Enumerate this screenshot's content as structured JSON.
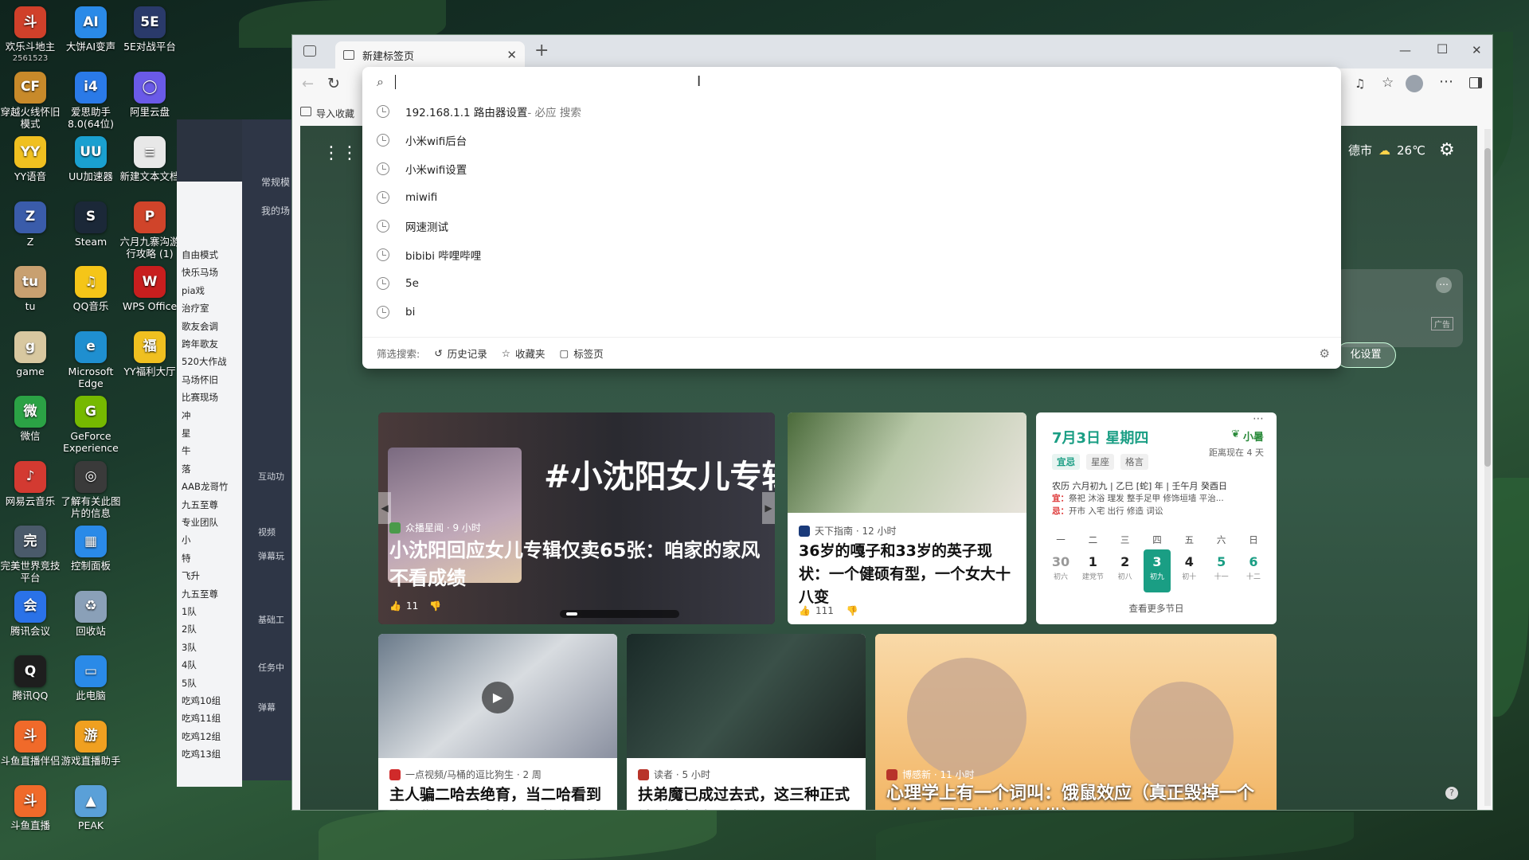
{
  "desktop": {
    "col1": [
      {
        "label": "欢乐斗地主",
        "sub": "2561523",
        "icon": "doudizhu-icon",
        "color": "#d0402a",
        "glyph": "斗"
      },
      {
        "label": "穿越火线怀旧模式",
        "icon": "cf-icon",
        "color": "#c88a2a",
        "glyph": "CF"
      },
      {
        "label": "YY语音",
        "icon": "yy-icon",
        "color": "#f0c020",
        "glyph": "YY"
      },
      {
        "label": "Z",
        "icon": "folder-z-icon",
        "color": "#3a5caa",
        "glyph": "Z"
      },
      {
        "label": "tu",
        "icon": "folder-tu-icon",
        "color": "#c8a070",
        "glyph": "tu"
      },
      {
        "label": "game",
        "icon": "folder-game-icon",
        "color": "#d8c8a0",
        "glyph": "g"
      },
      {
        "label": "微信",
        "icon": "wechat-icon",
        "color": "#2ba245",
        "glyph": "微"
      },
      {
        "label": "网易云音乐",
        "icon": "netease-music-icon",
        "color": "#d33a31",
        "glyph": "♪"
      },
      {
        "label": "完美世界竞技平台",
        "icon": "perfect-world-icon",
        "color": "#4a5a6a",
        "glyph": "完"
      },
      {
        "label": "腾讯会议",
        "icon": "tencent-meeting-icon",
        "color": "#2a72e8",
        "glyph": "会"
      },
      {
        "label": "腾讯QQ",
        "icon": "qq-icon",
        "color": "#1e1e1e",
        "glyph": "Q"
      },
      {
        "label": "斗鱼直播伴侣",
        "icon": "douyu-partner-icon",
        "color": "#f06a2a",
        "glyph": "斗"
      },
      {
        "label": "斗鱼直播",
        "icon": "douyu-icon",
        "color": "#f06a2a",
        "glyph": "斗"
      }
    ],
    "col2": [
      {
        "label": "大饼AI变声",
        "icon": "ai-voice-icon",
        "color": "#2a8ae8",
        "glyph": "AI"
      },
      {
        "label": "爱思助手8.0(64位)",
        "icon": "i4-icon",
        "color": "#2a7ae8",
        "glyph": "i4"
      },
      {
        "label": "UU加速器",
        "icon": "uu-icon",
        "color": "#1aa0d0",
        "glyph": "UU"
      },
      {
        "label": "Steam",
        "icon": "steam-icon",
        "color": "#1b2838",
        "glyph": "S"
      },
      {
        "label": "QQ音乐",
        "icon": "qq-music-icon",
        "color": "#f5c518",
        "glyph": "♫"
      },
      {
        "label": "Microsoft Edge",
        "icon": "edge-icon",
        "color": "#1f8fd0",
        "glyph": "e"
      },
      {
        "label": "GeForce Experience",
        "icon": "geforce-icon",
        "color": "#76b900",
        "glyph": "G"
      },
      {
        "label": "了解有关此图片的信息",
        "icon": "info-camera-icon",
        "color": "#3a3a3a",
        "glyph": "◎"
      },
      {
        "label": "控制面板",
        "icon": "control-panel-icon",
        "color": "#2a8ae8",
        "glyph": "▦"
      },
      {
        "label": "回收站",
        "icon": "recycle-bin-icon",
        "color": "#8aa0b8",
        "glyph": "♻"
      },
      {
        "label": "此电脑",
        "icon": "this-pc-icon",
        "color": "#2a8ae8",
        "glyph": "▭"
      },
      {
        "label": "游戏直播助手",
        "icon": "game-live-icon",
        "color": "#f0a020",
        "glyph": "游"
      },
      {
        "label": "PEAK",
        "icon": "peak-icon",
        "color": "#5aa0d8",
        "glyph": "▲"
      }
    ],
    "col3": [
      {
        "label": "5E对战平台",
        "icon": "5e-icon",
        "color": "#2a3a6a",
        "glyph": "5E"
      },
      {
        "label": "阿里云盘",
        "icon": "aliyun-drive-icon",
        "color": "#6a5ae8",
        "glyph": "◯"
      },
      {
        "label": "新建文本文档",
        "icon": "text-doc-icon",
        "color": "#e8e8e8",
        "glyph": "≡"
      },
      {
        "label": "六月九寨沟游行攻略 (1)",
        "icon": "ppt-icon",
        "color": "#d0442a",
        "glyph": "P"
      },
      {
        "label": "WPS Office",
        "icon": "wps-icon",
        "color": "#c81e1e",
        "glyph": "W"
      },
      {
        "label": "YY福利大厅",
        "icon": "yy-welfare-icon",
        "color": "#f0c020",
        "glyph": "福"
      }
    ]
  },
  "bgapp": {
    "tabs": [
      "常规模",
      "我的场"
    ],
    "tree": [
      "自由模式",
      "快乐马场",
      "pia戏",
      "治疗室",
      "歌友会调",
      "跨年歌友",
      "520大作战",
      "马场怀旧",
      "比赛现场",
      "冲",
      "星",
      "牛",
      "落",
      "AAB龙哥竹",
      "九五至尊",
      "专业团队",
      "小",
      "特",
      "飞升",
      "九五至尊",
      "1队",
      "2队",
      "3队",
      "4队",
      "5队",
      "吃鸡10组",
      "吃鸡11组",
      "吃鸡12组",
      "吃鸡13组"
    ],
    "side_labels": [
      "互动功",
      "视频",
      "弹幕玩",
      "基础工",
      "任务中",
      "弹幕"
    ]
  },
  "browser": {
    "tab_title": "新建标签页",
    "fav_import": "导入收藏",
    "search": {
      "value": "",
      "placeholder": ""
    },
    "suggestions": [
      {
        "text": "192.168.1.1 路由器设置",
        "suffix": " - 必应 搜索"
      },
      {
        "text": "小米wifi后台",
        "suffix": ""
      },
      {
        "text": "小米wifi设置",
        "suffix": ""
      },
      {
        "text": "miwifi",
        "suffix": ""
      },
      {
        "text": "网速测试",
        "suffix": ""
      },
      {
        "text": "bibibi 哔哩哔哩",
        "suffix": ""
      },
      {
        "text": "5e",
        "suffix": ""
      },
      {
        "text": "bi",
        "suffix": ""
      }
    ],
    "filter": {
      "label": "筛选搜索:",
      "history": "历史记录",
      "favorites": "收藏夹",
      "tabs": "标签页"
    },
    "weather": {
      "city": "德市",
      "temp": "26℃"
    },
    "personalize": "化设置",
    "ad_label": "广告"
  },
  "feed": {
    "hero": {
      "banner_text": "#小沈阳女儿专辑",
      "source": "众播星闻 · 9 小时",
      "title": "小沈阳回应女儿专辑仅卖65张：咱家的家风不看成绩",
      "likes": "11"
    },
    "card2": {
      "source": "天下指南 · 12 小时",
      "title": "36岁的嘎子和33岁的英子现状：一个健硕有型，一个女大十八变",
      "likes": "111"
    },
    "card3": {
      "source": "一点视频/马桶的逗比狗生 · 2 周",
      "title": "主人骗二哈去绝育，当二哈看到自己伤口后，大家千万憋住别笑"
    },
    "card4": {
      "source": "读者 · 5 小时",
      "title": "扶弟魔已成过去式，这三种正式被列入相亲黑名单"
    },
    "card5": {
      "source": "博感新 · 11 小时",
      "title": "心理学上有一个词叫：饿鼠效应（真正毁掉一个人的，是无节制的放纵）"
    }
  },
  "calendar": {
    "date": "7月3日 星期四",
    "term": "小暑",
    "countdown": "距离现在 4 天",
    "tabs": [
      "宜忌",
      "星座",
      "格言"
    ],
    "lunar": "农历 六月初九 | 乙巳 [蛇] 年 | 壬午月 癸酉日",
    "yi_label": "宜：",
    "yi": "祭祀 沐浴 理发 整手足甲 修饰垣墙 平治...",
    "ji_label": "忌：",
    "ji": "开市 入宅 出行 修造 词讼",
    "weekdays": [
      "一",
      "二",
      "三",
      "四",
      "五",
      "六",
      "日"
    ],
    "days": [
      {
        "d": "30",
        "l": "初六"
      },
      {
        "d": "1",
        "l": "建党节"
      },
      {
        "d": "2",
        "l": "初八"
      },
      {
        "d": "3",
        "l": "初九"
      },
      {
        "d": "4",
        "l": "初十"
      },
      {
        "d": "5",
        "l": "十一"
      },
      {
        "d": "6",
        "l": "十二"
      }
    ],
    "more": "查看更多节日"
  },
  "colors": {
    "accent": "#1a9e84",
    "brand_edge": "#0c6bd6"
  }
}
